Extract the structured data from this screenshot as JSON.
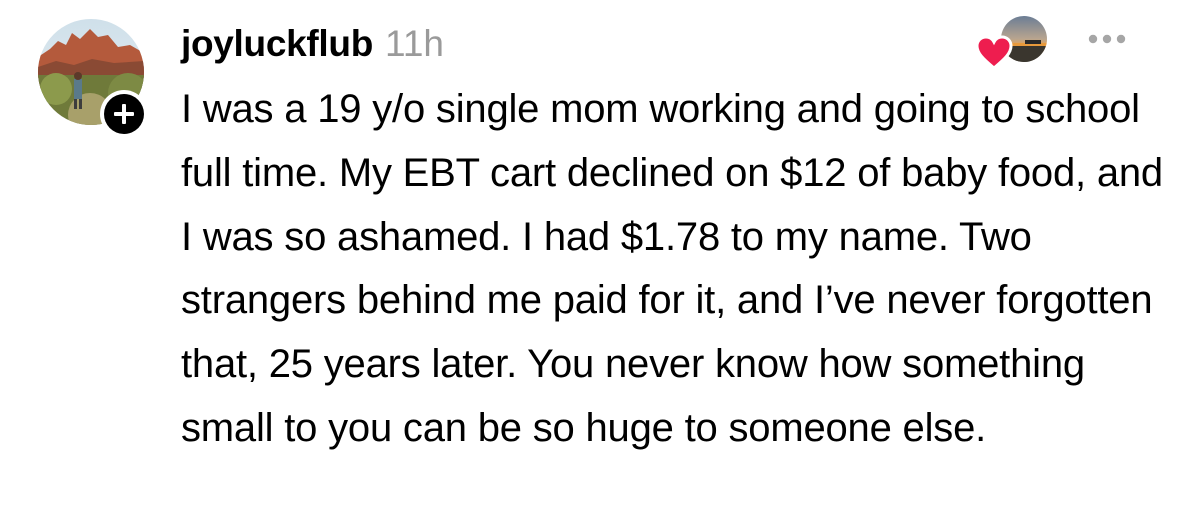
{
  "comment": {
    "username": "joyluckflub",
    "timestamp": "11h",
    "text": "I was a 19 y/o single mom working and going to school full time. My EBT cart declined on $12 of baby food, and I was so ashamed. I had $1.78 to my name. Two strangers behind me paid for it, and I’ve never forgotten that, 25 years later. You never know how something small to you can be so huge to someone else.",
    "avatar_icon": "avatar-mountain-photo",
    "follow_icon": "plus-icon",
    "liked_by_icon": "liker-sunset-avatar",
    "heart_icon": "heart-icon",
    "more_icon": "ellipsis-icon"
  },
  "colors": {
    "heart": "#ee1d4f",
    "timestamp": "#9a9a9a",
    "more_dots": "#a6a6a6",
    "badge": "#000000"
  }
}
